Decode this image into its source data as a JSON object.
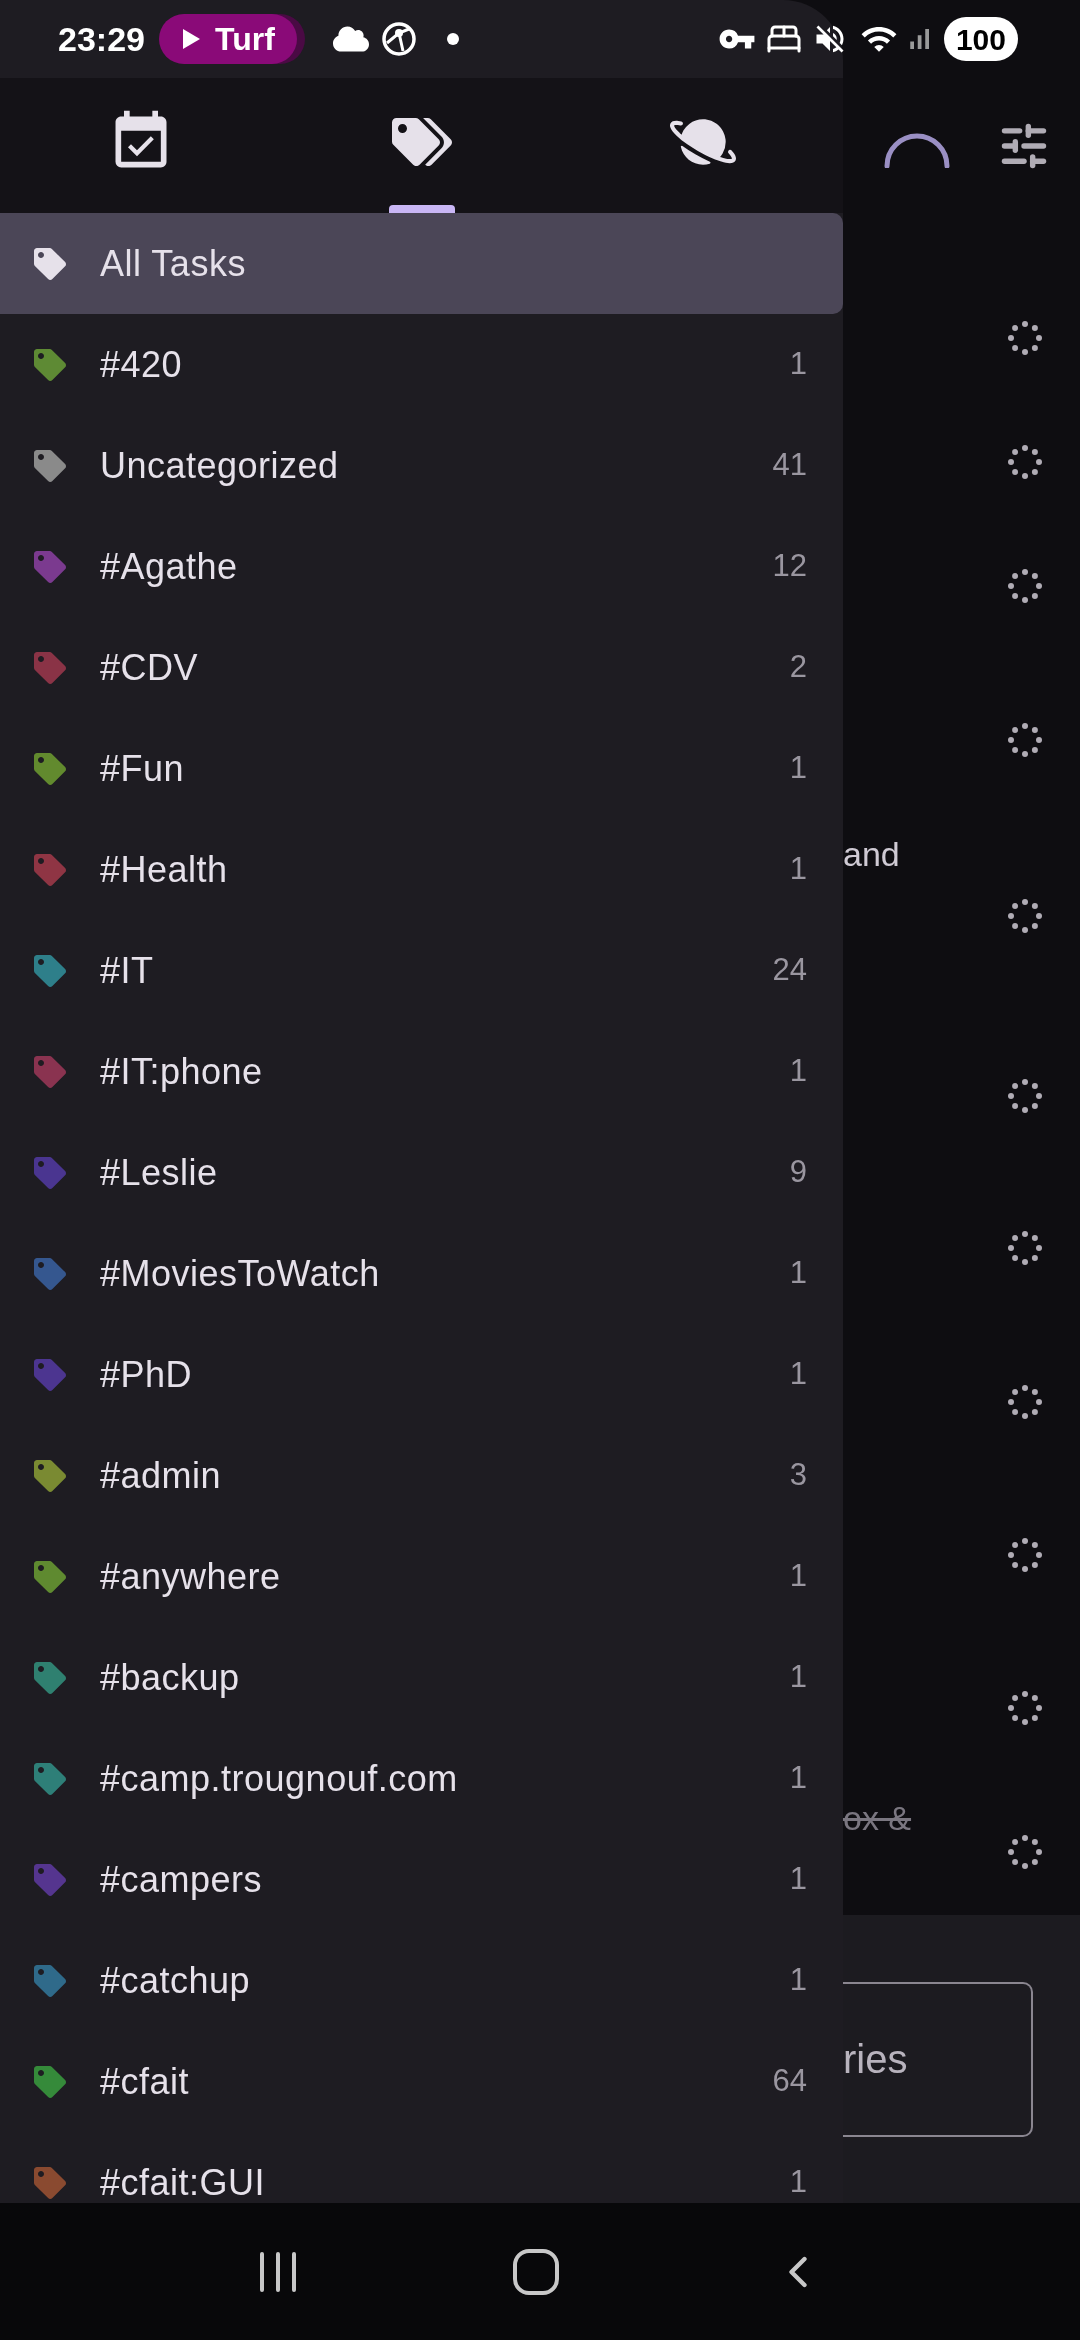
{
  "status_bar": {
    "time": "23:29",
    "media_chip": {
      "label": "Turf"
    },
    "battery": "100"
  },
  "drawer": {
    "tabs": [
      {
        "kind": "calendar",
        "selected": false
      },
      {
        "kind": "tags",
        "selected": true
      },
      {
        "kind": "planet",
        "selected": false
      }
    ],
    "items": [
      {
        "label": "All Tasks",
        "selected": true,
        "color": "#e6e1ea"
      },
      {
        "label": "#420",
        "count": "1",
        "selected": false,
        "color": "#5e8a34"
      },
      {
        "label": "Uncategorized",
        "count": "41",
        "selected": false,
        "color": "#8a8a8a"
      },
      {
        "label": "#Agathe",
        "count": "12",
        "selected": false,
        "color": "#7b3a8f"
      },
      {
        "label": "#CDV",
        "count": "2",
        "selected": false,
        "color": "#8a3346"
      },
      {
        "label": "#Fun",
        "count": "1",
        "selected": false,
        "color": "#628a2e"
      },
      {
        "label": "#Health",
        "count": "1",
        "selected": false,
        "color": "#8f3544"
      },
      {
        "label": "#IT",
        "count": "24",
        "selected": false,
        "color": "#2e7f8a"
      },
      {
        "label": "#IT:phone",
        "count": "1",
        "selected": false,
        "color": "#8a3350"
      },
      {
        "label": "#Leslie",
        "count": "9",
        "selected": false,
        "color": "#4a3590"
      },
      {
        "label": "#MoviesToWatch",
        "count": "1",
        "selected": false,
        "color": "#35578f"
      },
      {
        "label": "#PhD",
        "count": "1",
        "selected": false,
        "color": "#4c3590"
      },
      {
        "label": "#admin",
        "count": "3",
        "selected": false,
        "color": "#7a8a32"
      },
      {
        "label": "#anywhere",
        "count": "1",
        "selected": false,
        "color": "#5f8a30"
      },
      {
        "label": "#backup",
        "count": "1",
        "selected": false,
        "color": "#2f8070"
      },
      {
        "label": "#camp.trougnouf.com",
        "count": "1",
        "selected": false,
        "color": "#2e7f78"
      },
      {
        "label": "#campers",
        "count": "1",
        "selected": false,
        "color": "#55358f"
      },
      {
        "label": "#catchup",
        "count": "1",
        "selected": false,
        "color": "#2f6a8a"
      },
      {
        "label": "#cfait",
        "count": "64",
        "selected": false,
        "color": "#358a3a"
      },
      {
        "label": "#cfait:GUI",
        "count": "1",
        "selected": false,
        "color": "#8a4a30"
      }
    ]
  },
  "backdrop": {
    "texts": [
      {
        "text": "and",
        "struck": false
      },
      {
        "text": "ox &",
        "struck": true
      }
    ],
    "button": "ries"
  }
}
